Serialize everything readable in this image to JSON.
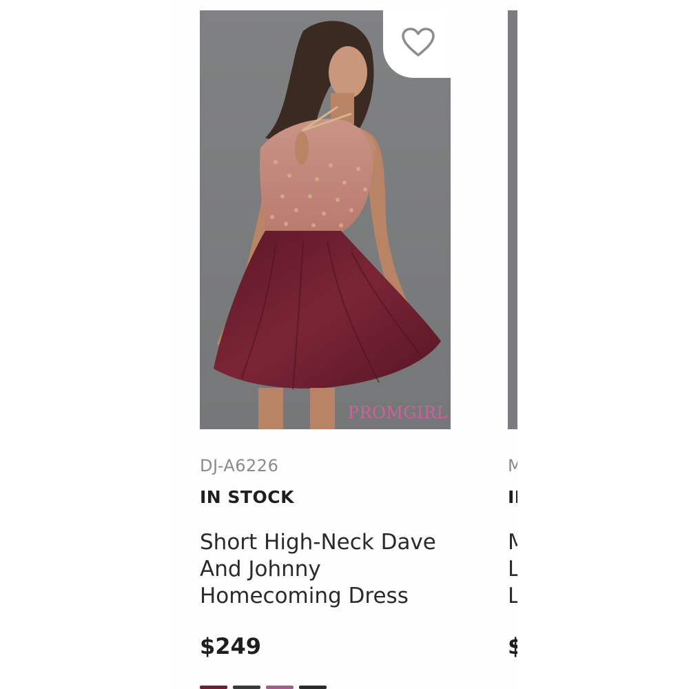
{
  "products": [
    {
      "sku": "DJ-A6226",
      "stock_status": "IN STOCK",
      "title_lines": [
        "Short High-Neck Dave",
        "And Johnny",
        "Homecoming Dress"
      ],
      "price": "$249",
      "image_watermark": "PROMGIRL",
      "favorite_icon": "heart-outline-icon",
      "swatch_colors": [
        "#6e2033",
        "#3a3a3a",
        "#a45b8e",
        "#2b2b2b"
      ]
    },
    {
      "sku": "M",
      "stock_status": "II",
      "title_lines": [
        "M",
        "L",
        "L"
      ],
      "price": "$"
    }
  ],
  "colors": {
    "photo_background": "#7b7c7d",
    "dress_burgundy": "#6c1e2d",
    "watermark_pink": "#d0609a",
    "sku_gray": "#8a8a8a",
    "text_dark": "#1f1f1f"
  }
}
